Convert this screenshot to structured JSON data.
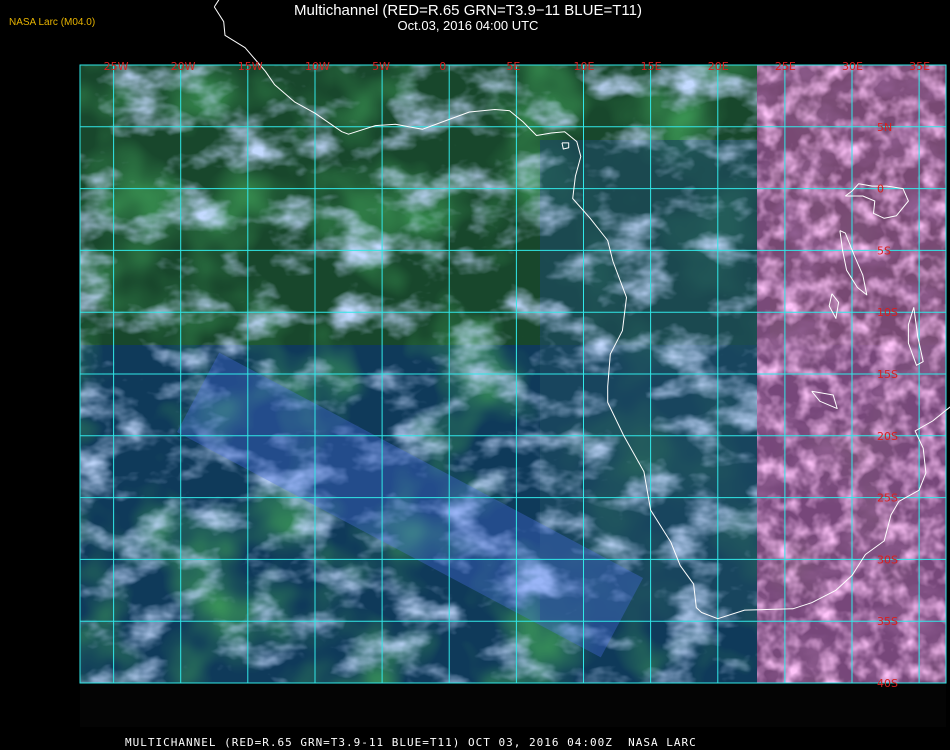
{
  "header": {
    "title": "Multichannel (RED=R.65 GRN=T3.9−11 BLUE=T11)",
    "subtitle": "Oct.03, 2016 04:00 UTC",
    "brand": "NASA Larc (M04.0)"
  },
  "footer": {
    "text": "MULTICHANNEL (RED=R.65 GRN=T3.9-11 BLUE=T11) OCT 03, 2016 04:00Z  NASA LARC"
  },
  "map": {
    "lon_range": [
      -27.5,
      37
    ],
    "lat_range": [
      -40,
      10
    ],
    "grid_step_deg": 5,
    "grid_color": "#30e8e8",
    "label_color": "#d82020",
    "coast_color": "#ffffff",
    "lon_labels": [
      "25W",
      "20W",
      "15W",
      "10W",
      "5W",
      "0",
      "5E",
      "10E",
      "15E",
      "20E",
      "25E",
      "30E",
      "35E"
    ],
    "lat_labels": [
      "5N",
      "0",
      "5S",
      "10S",
      "15S",
      "20S",
      "25S",
      "30S",
      "35S",
      "40S"
    ]
  }
}
